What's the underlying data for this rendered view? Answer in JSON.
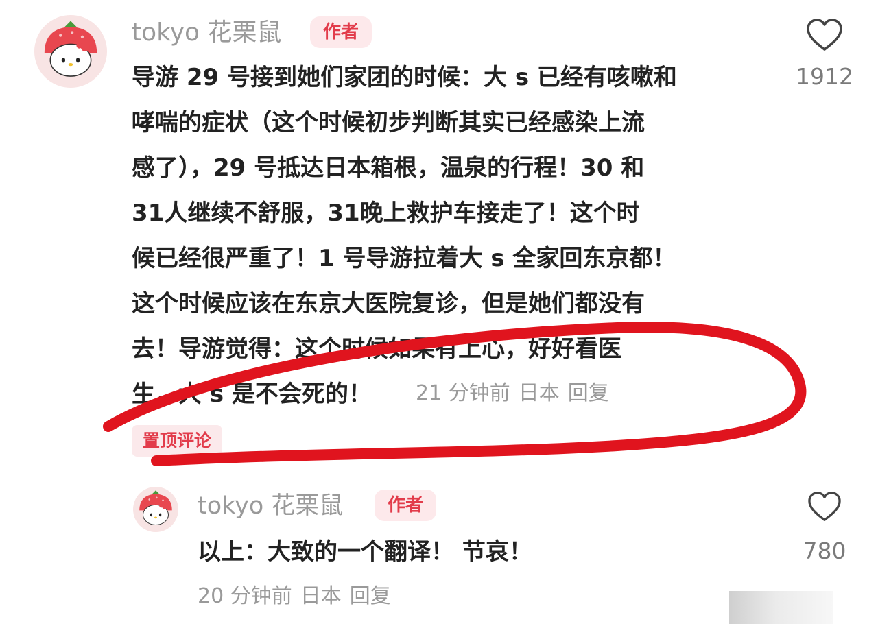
{
  "comment": {
    "username": "tokyo 花栗鼠",
    "badge": "作者",
    "lines": [
      "导游 29 号接到她们家团的时候：大 s 已经有咳嗽和",
      "哮喘的症状（这个时候初步判断其实已经感染上流",
      "感了），29 号抵达日本箱根，温泉的行程！30 和",
      " 31人继续不舒服，31晚上救护车接走了！这个时",
      "候已经很严重了！1 号导游拉着大 s 全家回东京都！",
      "这个时候应该在东京大医院复诊，但是她们都没有",
      "去！导游觉得：这个时候如果有上心，好好看医",
      "生，大 s 是不会死的！"
    ],
    "time": "21 分钟前",
    "location": "日本",
    "reply": "回复",
    "likes": "1912",
    "pinned_label": "置顶评论"
  },
  "reply_comment": {
    "username": "tokyo 花栗鼠",
    "badge": "作者",
    "text": "以上：大致的一个翻译！ 节哀！",
    "time": "20 分钟前",
    "location": "日本",
    "reply": "回复",
    "likes": "780"
  },
  "colors": {
    "accent": "#e23c4b",
    "badge_bg": "#fde9eb",
    "muted_text": "#9a9a9a",
    "annotation": "#e0141e"
  },
  "icons": {
    "avatar": "hello-kitty-strawberry-avatar",
    "like": "heart-outline-icon"
  }
}
